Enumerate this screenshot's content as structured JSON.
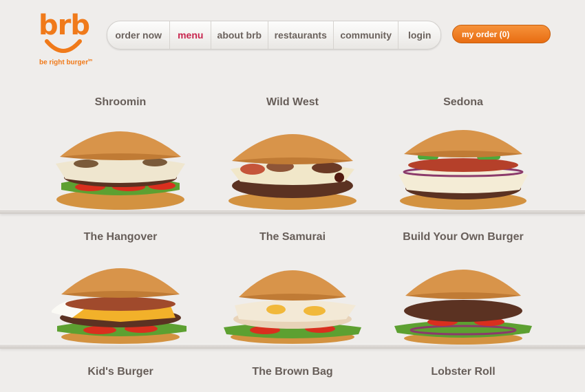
{
  "brand": {
    "name": "brb",
    "tagline": "be right burger",
    "tm": "tm",
    "accent": "#f07a1a"
  },
  "nav": {
    "items": [
      {
        "label": "order now"
      },
      {
        "label": "menu",
        "active": true
      },
      {
        "label": "about brb"
      },
      {
        "label": "restaurants"
      },
      {
        "label": "community"
      },
      {
        "label": "login"
      }
    ]
  },
  "cart": {
    "label": "my order (0)"
  },
  "menu": {
    "rows": [
      [
        {
          "title": "Shroomin"
        },
        {
          "title": "Wild West"
        },
        {
          "title": "Sedona"
        }
      ],
      [
        {
          "title": "The Hangover"
        },
        {
          "title": "The Samurai"
        },
        {
          "title": "Build Your Own Burger"
        }
      ],
      [
        {
          "title": "Kid's Burger"
        },
        {
          "title": "The Brown Bag"
        },
        {
          "title": "Lobster Roll"
        }
      ]
    ]
  }
}
